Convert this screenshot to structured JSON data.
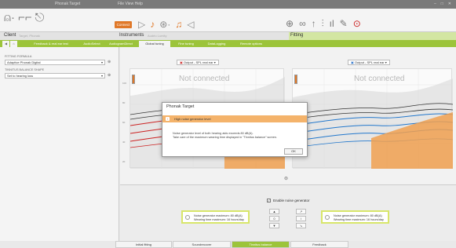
{
  "titlebar": {
    "app_title": "Phonak Target",
    "menu": "File  View  Help  ",
    "right_items": [
      "",
      "",
      ""
    ]
  },
  "toolbar": {
    "connect_label": "Connect"
  },
  "client": {
    "label": "Client",
    "value": "Target, Phonak",
    "instruments_label": "Instruments",
    "instruments_value": "Audéo Lumity",
    "fitting_label": "Fitting",
    "fitting_value": ""
  },
  "tabs": [
    "Feedback & real ear test",
    "AudioSelect",
    "Global tuning",
    "Fine tuning",
    "DataLogging",
    "Remote options"
  ],
  "active_tab_index": 2,
  "nav": {
    "back": "",
    "home": ""
  },
  "left_panel": {
    "fitting_formula_label": "Fitting formula",
    "fitting_formula_value": "Adaptive Phonak Digital",
    "tinnitus_balance_label": "Tinnitus balance shape",
    "tinnitus_balance_value": "Set to hearing loss"
  },
  "charts": {
    "left_select": "Output - SPL real ear",
    "right_select": "Output - SPL real ear",
    "not_connected": "Not connected",
    "y_ticks": [
      "100",
      "80",
      "60",
      "40",
      "20"
    ]
  },
  "lower": {
    "enable_label": "Enable noise generator",
    "left_box_line1": "Noise generator maximum: 80 dB(A)",
    "left_box_line2": "Wearing time maximum: 16 hours/day",
    "right_box_line1": "Noise generator maximum: 80 dB(A)",
    "right_box_line2": "Wearing time maximum: 16 hours/day",
    "btn_up": "▲",
    "btn_down": "▼",
    "btn_mid": "0"
  },
  "bottom_tabs": [
    "Initial fitting",
    "Soundrecover",
    "Tinnitus balance",
    "Feedback"
  ],
  "bottom_active_index": 2,
  "dialog": {
    "title": "Phonak Target",
    "warning": "High noise generator level",
    "message_line1": "Noise generator level of both hearing aids exceeds 80 dB(A).",
    "message_line2": "Take care of the maximum wearing time displayed in \"Tinnitus balance\" screen.",
    "ok_label": "OK"
  },
  "colors": {
    "accent_green": "#9cc43a",
    "accent_orange": "#e07828",
    "dialog_band": "#f4b36b",
    "highlight_box": "#d8e66a"
  },
  "icons": {
    "audiogram": "audiogram-icon",
    "instrument": "instrument-icon",
    "fitting": "fitting-icon",
    "session": "session-icon",
    "settings": "settings-icon",
    "bell": "bell-icon"
  }
}
